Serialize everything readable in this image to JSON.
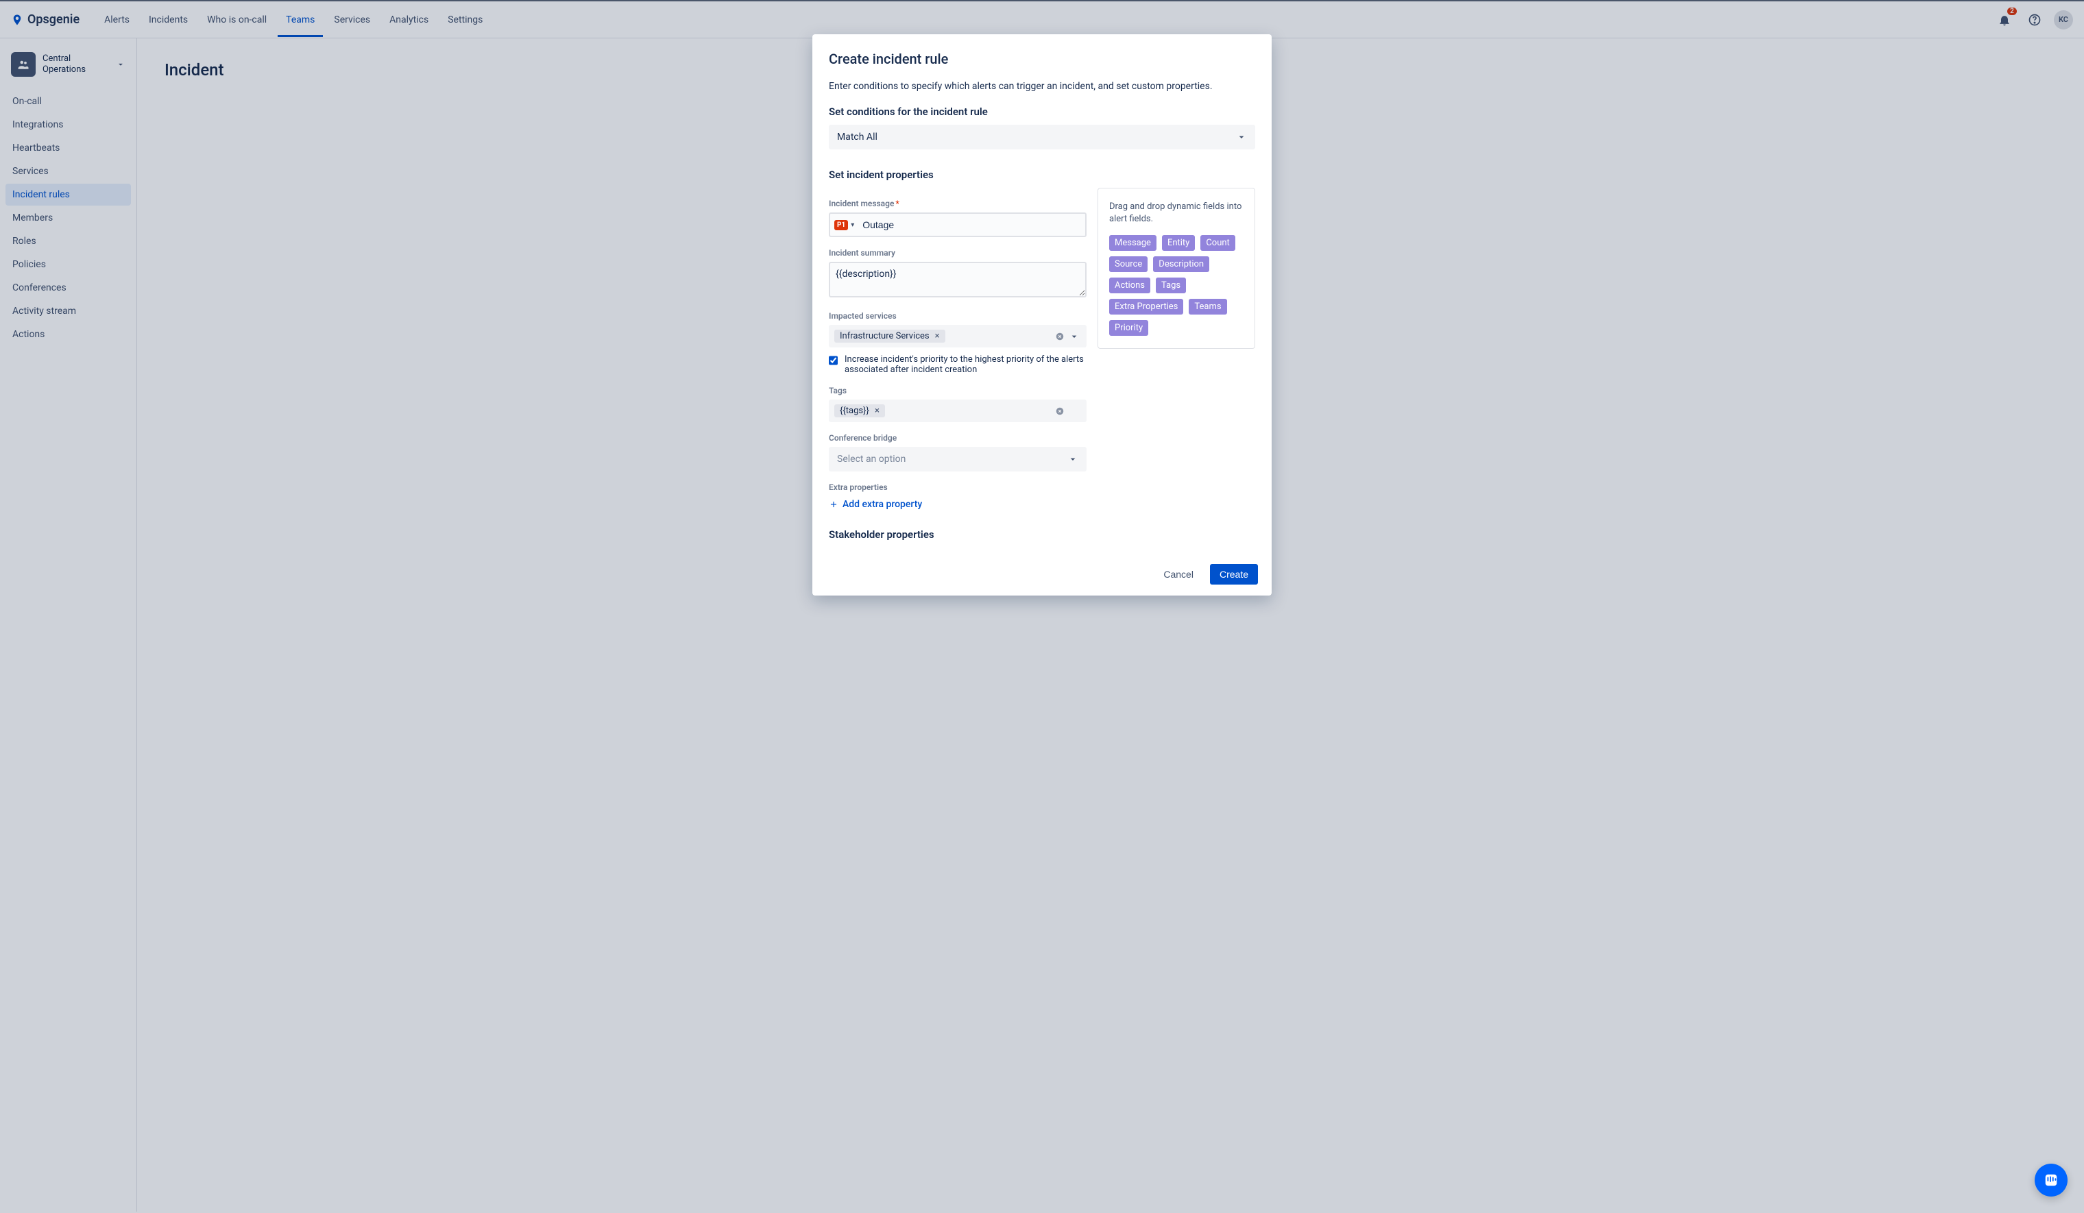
{
  "header": {
    "brand": "Opsgenie",
    "nav": [
      "Alerts",
      "Incidents",
      "Who is on-call",
      "Teams",
      "Services",
      "Analytics",
      "Settings"
    ],
    "active_nav_index": 3,
    "notification_count": "2",
    "avatar_initials": "KC"
  },
  "sidebar": {
    "team_name": "Central Operations",
    "items": [
      "On-call",
      "Integrations",
      "Heartbeats",
      "Services",
      "Incident rules",
      "Members",
      "Roles",
      "Policies",
      "Conferences",
      "Activity stream",
      "Actions"
    ],
    "active_index": 4
  },
  "page": {
    "title": "Incident"
  },
  "modal": {
    "title": "Create incident rule",
    "description": "Enter conditions to specify which alerts can trigger an incident, and set custom properties.",
    "conditions_heading": "Set conditions for the incident rule",
    "match_mode": "Match All",
    "properties_heading": "Set incident properties",
    "incident_message_label": "Incident message",
    "priority_badge": "P1",
    "incident_message_value": "Outage",
    "incident_summary_label": "Incident summary",
    "incident_summary_value": "{{description}}",
    "impacted_services_label": "Impacted services",
    "impacted_services": [
      "Infrastructure Services"
    ],
    "increase_priority_label": "Increase incident's priority to the highest priority of the alerts associated after incident creation",
    "increase_priority_checked": true,
    "tags_label": "Tags",
    "tags": [
      "{{tags}}"
    ],
    "conference_bridge_label": "Conference bridge",
    "conference_placeholder": "Select an option",
    "extra_properties_label": "Extra properties",
    "add_extra_property": "Add extra property",
    "stakeholder_heading": "Stakeholder properties",
    "dynfields_hint": "Drag and drop dynamic fields into alert fields.",
    "dynfields": [
      "Message",
      "Entity",
      "Count",
      "Source",
      "Description",
      "Actions",
      "Tags",
      "Extra Properties",
      "Teams",
      "Priority"
    ],
    "cancel_label": "Cancel",
    "create_label": "Create"
  }
}
